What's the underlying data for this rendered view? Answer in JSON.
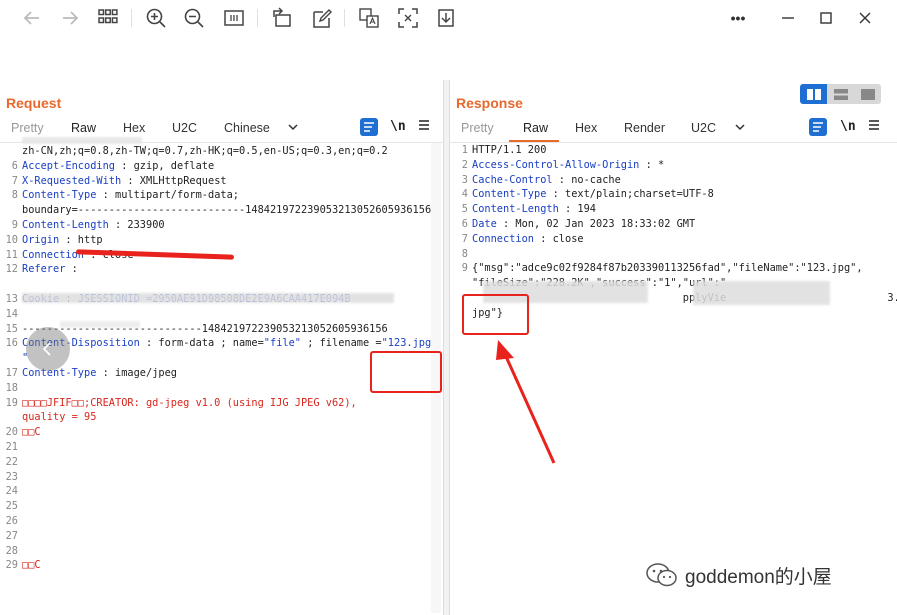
{
  "toolbar": {
    "icons": [
      "arrow-left-icon",
      "arrow-right-icon",
      "grid-icon",
      "zoom-in-icon",
      "zoom-out-icon",
      "fit-icon",
      "rotate-icon",
      "edit-icon",
      "translate-icon",
      "scan-icon",
      "download-icon"
    ],
    "more_label": "•••"
  },
  "request": {
    "title": "Request",
    "tabs": [
      "Pretty",
      "Raw",
      "Hex",
      "U2C",
      "Chinese"
    ],
    "active_tab": "Raw",
    "newline_label": "\\n",
    "lines": [
      {
        "n": "",
        "t": "zh-CN,zh;q=0.8,zh-TW;q=0.7,zh-HK;q=0.5,en-US;q=0.3,en;q=0.2"
      },
      {
        "n": "6",
        "k": "Accept-Encoding",
        "v": " : gzip, deflate"
      },
      {
        "n": "7",
        "k": "X-Requested-With",
        "v": " : XMLHttpRequest"
      },
      {
        "n": "8",
        "k": "Content-Type",
        "v": " : multipart/form-data;"
      },
      {
        "n": "",
        "t": "boundary=---------------------------148421972239053213052605936156"
      },
      {
        "n": "9",
        "k": "Content-Length",
        "v": " : 233900"
      },
      {
        "n": "10",
        "k": "Origin",
        "v": " : http"
      },
      {
        "n": "11",
        "k": "Connection",
        "v": " : close"
      },
      {
        "n": "12",
        "k": "Referer",
        "v": " :"
      },
      {
        "n": "",
        "t": ""
      },
      {
        "n": "13",
        "k": "Cookie",
        "v": " : ",
        "s": "JSESSIONID =2950AE91D98508DE2E9A6CAA417E094B"
      },
      {
        "n": "14",
        "t": ""
      },
      {
        "n": "15",
        "t": "-----------------------------148421972239053213052605936156"
      },
      {
        "n": "16",
        "k": "Content-Disposition",
        "v": " : form-data ; name=",
        "s": "\"file\"",
        "v2": " ; filename =",
        "s2": "\"123.jpg"
      },
      {
        "n": "",
        "s": "\""
      },
      {
        "n": "17",
        "k": "Content-Type",
        "v": " : image/jpeg"
      },
      {
        "n": "18",
        "t": ""
      },
      {
        "n": "19",
        "r": "□□□□JFIF□□;CREATOR: gd-jpeg v1.0 (using IJG JPEG v62),"
      },
      {
        "n": "",
        "r": "quality = 95"
      },
      {
        "n": "20",
        "r": "□□C"
      },
      {
        "n": "21",
        "t": ""
      },
      {
        "n": "22",
        "t": ""
      },
      {
        "n": "23",
        "t": ""
      },
      {
        "n": "24",
        "t": ""
      },
      {
        "n": "25",
        "t": ""
      },
      {
        "n": "26",
        "t": ""
      },
      {
        "n": "27",
        "t": ""
      },
      {
        "n": "28",
        "t": ""
      },
      {
        "n": "29",
        "r": "□□C"
      }
    ]
  },
  "response": {
    "title": "Response",
    "tabs": [
      "Pretty",
      "Raw",
      "Hex",
      "Render",
      "U2C"
    ],
    "active_tab": "Raw",
    "newline_label": "\\n",
    "lines": [
      {
        "n": "1",
        "t": "HTTP/1.1 200"
      },
      {
        "n": "2",
        "k": "Access-Control-Allow-Origin",
        "v": " : *"
      },
      {
        "n": "3",
        "k": "Cache-Control",
        "v": " : no-cache"
      },
      {
        "n": "4",
        "k": "Content-Type",
        "v": " : text/plain;charset=UTF-8"
      },
      {
        "n": "5",
        "k": "Content-Length",
        "v": " : 194"
      },
      {
        "n": "6",
        "k": "Date",
        "v": " : Mon, 02 Jan 2023 18:33:02 GMT"
      },
      {
        "n": "7",
        "k": "Connection",
        "v": " : close"
      },
      {
        "n": "8",
        "t": ""
      },
      {
        "n": "9",
        "t": "{\"msg\":\"adce9c02f9284f87b203390113256fad\",\"fileName\":\"123.jpg\","
      },
      {
        "n": "",
        "t": "\"fileSize\":\"228.2K\",\"success\":\"1\",\"url\":\""
      },
      {
        "n": "",
        "t": "                                  pplyVie                          3."
      },
      {
        "n": "",
        "t": "jpg\"}"
      }
    ]
  },
  "watermark": {
    "text": "goddemon的小屋"
  },
  "colors": {
    "accent": "#e8692c",
    "key": "#1a3fc4",
    "annotation": "#e8221c",
    "active_button": "#1e6fd1"
  }
}
